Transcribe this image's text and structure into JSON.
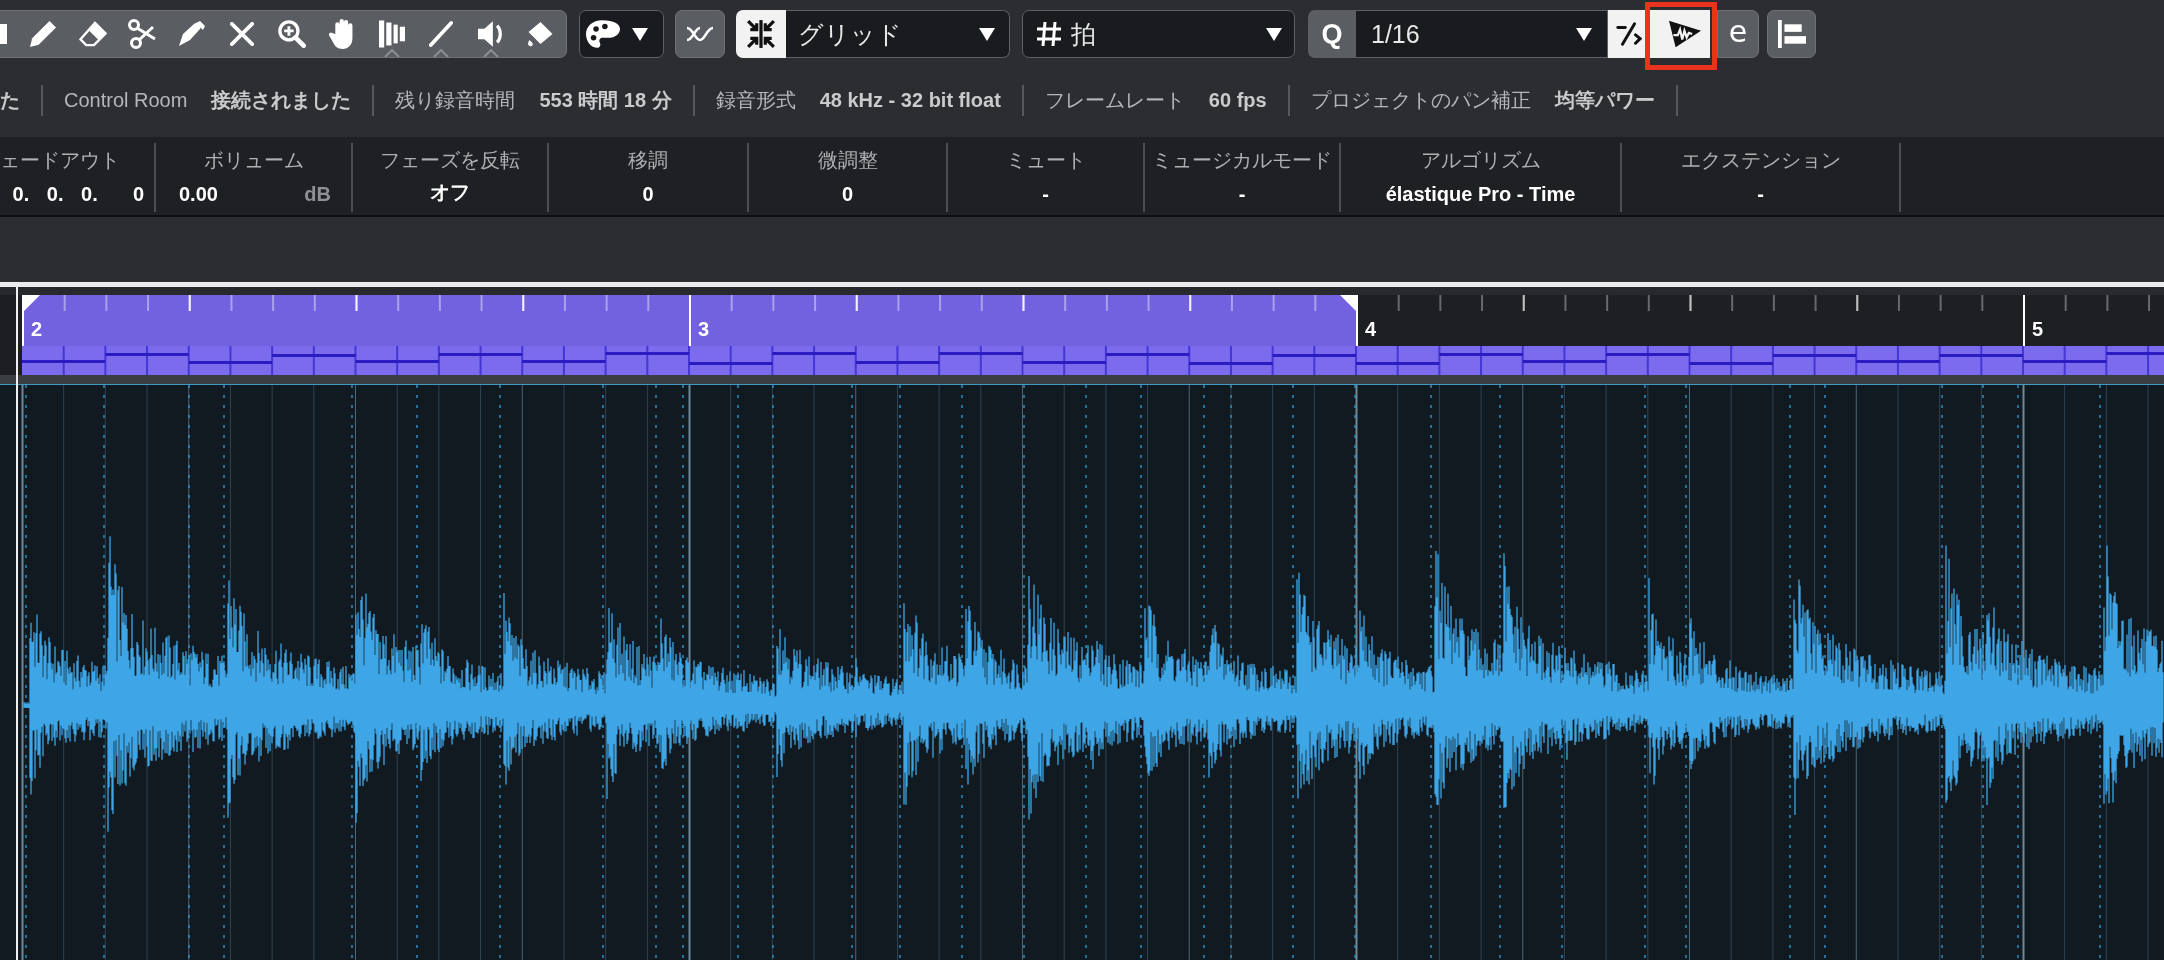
{
  "toolbar": {
    "curves_toggle": {
      "on": false
    },
    "snap": {
      "on": true,
      "value": "グリッド"
    },
    "grid_type": {
      "value": "拍"
    },
    "quantize": {
      "label": "Q",
      "value": "1/16"
    },
    "toggles": [
      {
        "kind": "fraction",
        "on": true,
        "highlighted": false
      },
      {
        "kind": "waveform",
        "on": true,
        "highlighted": true
      },
      {
        "kind": "letter",
        "label": "e",
        "on": false,
        "highlighted": false
      }
    ],
    "align_toggle": {
      "on": false
    }
  },
  "status_line": [
    {
      "value": "た"
    },
    {
      "label": "Control Room",
      "value": "接続されました"
    },
    {
      "label": "残り録音時間",
      "value": "553 時間 18 分"
    },
    {
      "label": "録音形式",
      "value": "48 kHz - 32 bit float"
    },
    {
      "label": "フレームレート",
      "value": "60 fps"
    },
    {
      "label": "プロジェクトのパン補正",
      "value": "均等パワー"
    }
  ],
  "info_line": [
    {
      "label": "ェードアウト",
      "value": "0. 0. 0.  0"
    },
    {
      "label": "ボリューム",
      "value": "0.00",
      "unit": "dB"
    },
    {
      "label": "フェーズを反転",
      "value": "オフ"
    },
    {
      "label": "移調",
      "value": "0"
    },
    {
      "label": "微調整",
      "value": "0"
    },
    {
      "label": "ミュート",
      "value": "-"
    },
    {
      "label": "ミュージカルモード",
      "value": "-"
    },
    {
      "label": "アルゴリズム",
      "value": "élastique Pro - Time"
    },
    {
      "label": "エクステンション",
      "value": "-"
    }
  ],
  "ruler": {
    "bars": [
      {
        "label": "2",
        "selected": true
      },
      {
        "label": "3",
        "selected": true
      },
      {
        "label": "4",
        "selected": false
      },
      {
        "label": "5",
        "selected": false
      }
    ]
  }
}
